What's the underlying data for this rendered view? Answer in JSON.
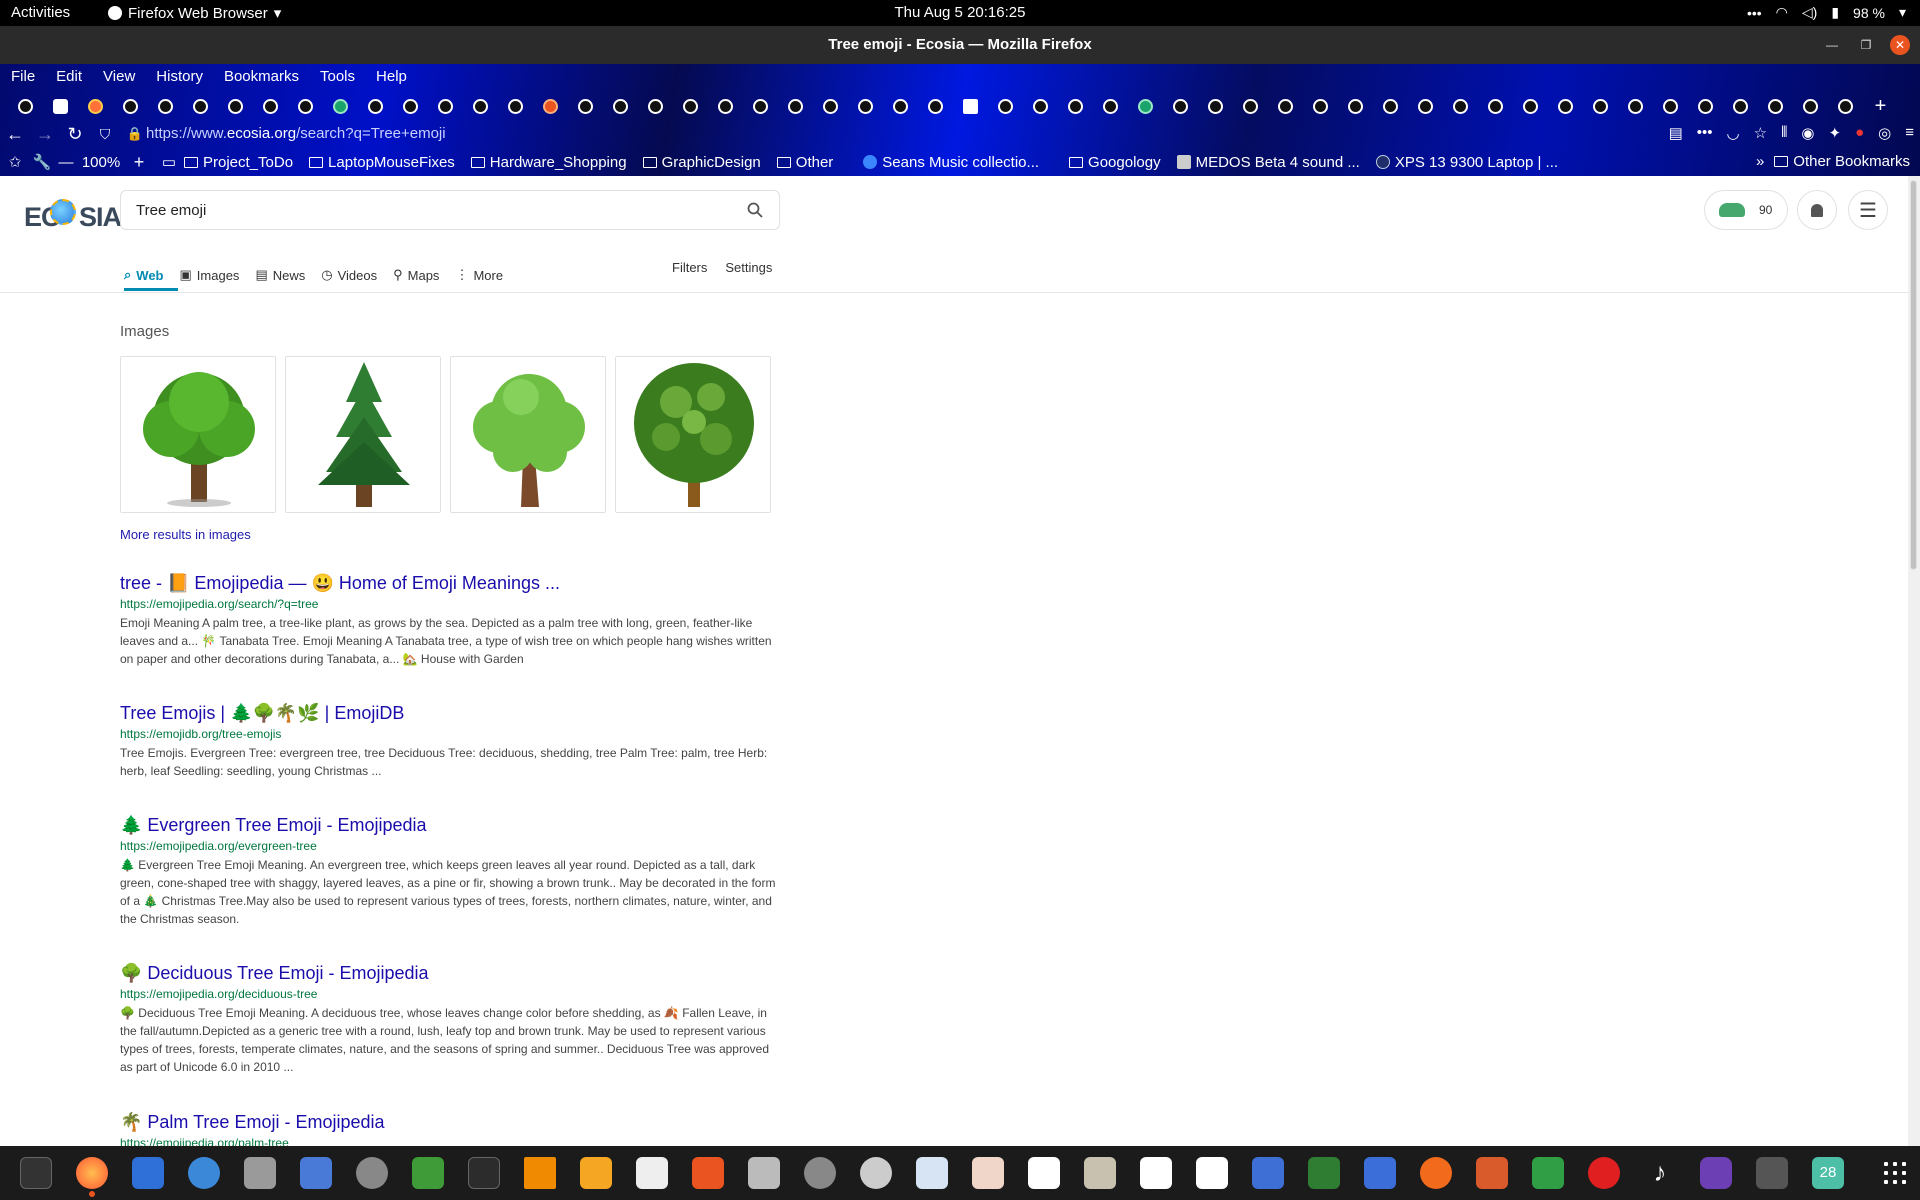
{
  "topbar": {
    "activities": "Activities",
    "app_name": "Firefox Web Browser",
    "clock": "Thu Aug 5  20:16:25",
    "battery": "98 %"
  },
  "window": {
    "title": "Tree emoji - Ecosia — Mozilla Firefox"
  },
  "menu": [
    "File",
    "Edit",
    "View",
    "History",
    "Bookmarks",
    "Tools",
    "Help"
  ],
  "urlbar": {
    "url_prefix": "https://www.",
    "url_domain": "ecosia.org",
    "url_suffix": "/search?q=Tree+emoji",
    "zoom": "100%"
  },
  "bookmarks": [
    {
      "label": "Project_ToDo",
      "icon": "folder-icon"
    },
    {
      "label": "LaptopMouseFixes",
      "icon": "folder-icon"
    },
    {
      "label": "Hardware_Shopping",
      "icon": "folder-icon"
    },
    {
      "label": "GraphicDesign",
      "icon": "folder-icon"
    },
    {
      "label": "Other",
      "icon": "folder-icon"
    },
    {
      "label": "Seans Music collectio...",
      "icon": "site-favicon"
    },
    {
      "label": "Googology",
      "icon": "folder-icon"
    },
    {
      "label": "MEDOS Beta 4 sound ...",
      "icon": "site-favicon"
    },
    {
      "label": "XPS 13 9300 Laptop | ...",
      "icon": "site-favicon"
    }
  ],
  "other_bookmarks": "Other Bookmarks",
  "search": {
    "query": "Tree emoji"
  },
  "tree_count": "90",
  "tabs": [
    "Web",
    "Images",
    "News",
    "Videos",
    "Maps",
    "More"
  ],
  "tools": [
    "Filters",
    "Settings"
  ],
  "images_label": "Images",
  "more_images": "More results in images",
  "results": [
    {
      "title": "tree - 📙 Emojipedia — 😃 Home of Emoji Meanings ...",
      "url": "https://emojipedia.org/search/?q=tree",
      "desc": "Emoji Meaning A palm tree, a tree-like plant, as grows by the sea. Depicted as a palm tree with long, green, feather-like leaves and a... 🎋 Tanabata Tree. Emoji Meaning A Tanabata tree, a type of wish tree on which people hang wishes written on paper and other decorations during Tanabata, a... 🏡 House with Garden"
    },
    {
      "title": "Tree Emojis | 🌲🌳🌴🌿 | EmojiDB",
      "url": "https://emojidb.org/tree-emojis",
      "desc": "Tree Emojis. Evergreen Tree: evergreen tree, tree Deciduous Tree: deciduous, shedding, tree Palm Tree: palm, tree Herb: herb, leaf Seedling: seedling, young Christmas ..."
    },
    {
      "title": "🌲 Evergreen Tree Emoji - Emojipedia",
      "url": "https://emojipedia.org/evergreen-tree",
      "desc": "🌲 Evergreen Tree Emoji Meaning. An evergreen tree, which keeps green leaves all year round. Depicted as a tall, dark green, cone-shaped tree with shaggy, layered leaves, as a pine or fir, showing a brown trunk.. May be decorated in the form of a 🎄 Christmas Tree.May also be used to represent various types of trees, forests, northern climates, nature, winter, and the Christmas season."
    },
    {
      "title": "🌳 Deciduous Tree Emoji - Emojipedia",
      "url": "https://emojipedia.org/deciduous-tree",
      "desc": "🌳 Deciduous Tree Emoji Meaning. A deciduous tree, whose leaves change color before shedding, as 🍂 Fallen Leave, in the fall/autumn.Depicted as a generic tree with a round, lush, leafy top and brown trunk. May be used to represent various types of trees, forests, temperate climates, nature, and the seasons of spring and summer.. Deciduous Tree was approved as part of Unicode 6.0 in 2010 ..."
    },
    {
      "title": "🌴 Palm Tree Emoji - Emojipedia",
      "url": "https://emojipedia.org/palm-tree",
      "desc": ""
    }
  ],
  "taskbar_badge": "28"
}
